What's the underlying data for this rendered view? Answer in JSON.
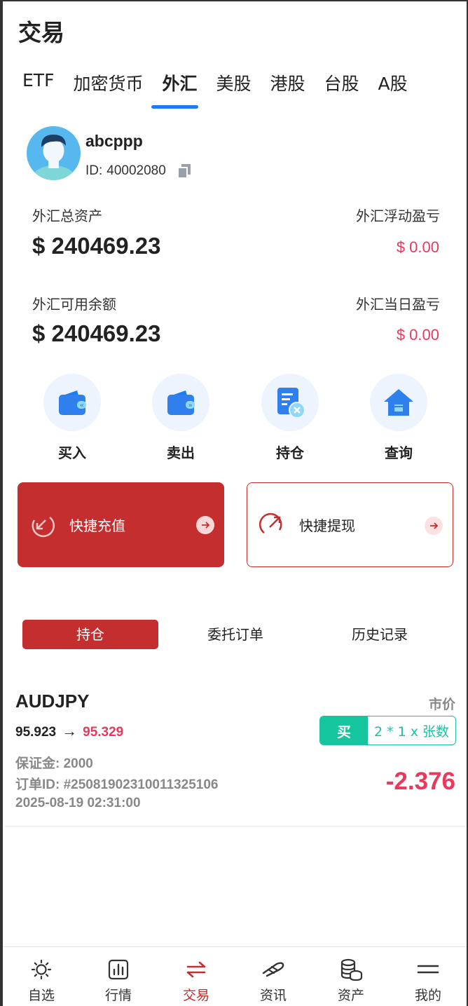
{
  "header": {
    "title": "交易"
  },
  "tabs": [
    {
      "label": "ETF"
    },
    {
      "label": "加密货币"
    },
    {
      "label": "外汇",
      "active": true
    },
    {
      "label": "美股"
    },
    {
      "label": "港股"
    },
    {
      "label": "台股"
    },
    {
      "label": "A股"
    }
  ],
  "user": {
    "name": "abcppp",
    "id_label": "ID:",
    "id_value": "40002080"
  },
  "stats": {
    "total_assets_label": "外汇总资产",
    "total_assets_value": "$ 240469.23",
    "floating_pnl_label": "外汇浮动盈亏",
    "floating_pnl_value": "$ 0.00",
    "available_label": "外汇可用余额",
    "available_value": "$ 240469.23",
    "daily_pnl_label": "外汇当日盈亏",
    "daily_pnl_value": "$ 0.00"
  },
  "actions": [
    {
      "label": "买入",
      "icon": "wallet-buy-icon"
    },
    {
      "label": "卖出",
      "icon": "wallet-sell-icon"
    },
    {
      "label": "持仓",
      "icon": "position-doc-icon"
    },
    {
      "label": "查询",
      "icon": "house-query-icon"
    }
  ],
  "quick": {
    "deposit_label": "快捷充值",
    "withdraw_label": "快捷提现"
  },
  "subtabs": [
    {
      "label": "持仓",
      "active": true
    },
    {
      "label": "委托订单"
    },
    {
      "label": "历史记录"
    }
  ],
  "position": {
    "symbol": "AUDJPY",
    "order_type": "市价",
    "open_price": "95.923",
    "arrow": "→",
    "current_price": "95.329",
    "side": "买",
    "quantity": "2 * 1 x 张数",
    "margin": "保证金: 2000",
    "order_id": "订单ID: #25081902310011325106",
    "time": "2025-08-19 02:31:00",
    "pnl": "-2.376"
  },
  "bottom_nav": [
    {
      "label": "自选",
      "icon": "sun-icon"
    },
    {
      "label": "行情",
      "icon": "chart-icon"
    },
    {
      "label": "交易",
      "icon": "exchange-icon",
      "active": true
    },
    {
      "label": "资讯",
      "icon": "news-icon"
    },
    {
      "label": "资产",
      "icon": "coins-icon"
    },
    {
      "label": "我的",
      "icon": "menu-icon"
    }
  ],
  "colors": {
    "accent_blue": "#1e7cf2",
    "brand_red": "#c42e2e",
    "loss_red": "#e83a5c",
    "buy_green": "#14c59e"
  }
}
